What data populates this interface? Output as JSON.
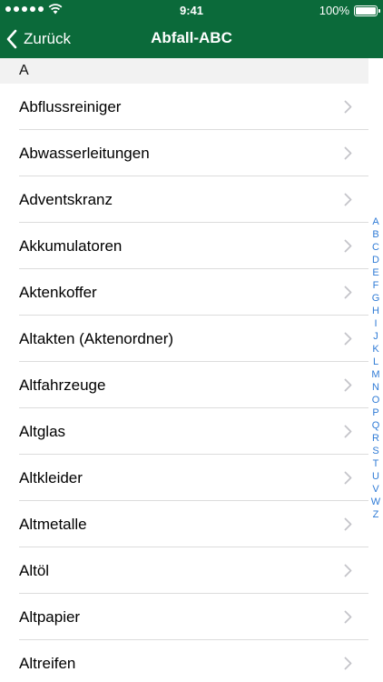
{
  "status": {
    "time": "9:41",
    "battery": "100%",
    "battery_level": 1.0
  },
  "nav": {
    "back_label": "Zurück",
    "title": "Abfall-ABC"
  },
  "section": {
    "letter": "A"
  },
  "items": [
    {
      "label": "Abflussreiniger"
    },
    {
      "label": "Abwasserleitungen"
    },
    {
      "label": "Adventskranz"
    },
    {
      "label": "Akkumulatoren"
    },
    {
      "label": "Aktenkoffer"
    },
    {
      "label": "Altakten (Aktenordner)"
    },
    {
      "label": "Altfahrzeuge"
    },
    {
      "label": "Altglas"
    },
    {
      "label": "Altkleider"
    },
    {
      "label": "Altmetalle"
    },
    {
      "label": "Altöl"
    },
    {
      "label": "Altpapier"
    },
    {
      "label": "Altreifen"
    }
  ],
  "index": [
    "A",
    "B",
    "C",
    "D",
    "E",
    "F",
    "G",
    "H",
    "I",
    "J",
    "K",
    "L",
    "M",
    "N",
    "O",
    "P",
    "Q",
    "R",
    "S",
    "T",
    "U",
    "V",
    "W",
    "Z"
  ],
  "colors": {
    "header_bg": "#0b6a3a",
    "index_color": "#2f7bd6"
  }
}
